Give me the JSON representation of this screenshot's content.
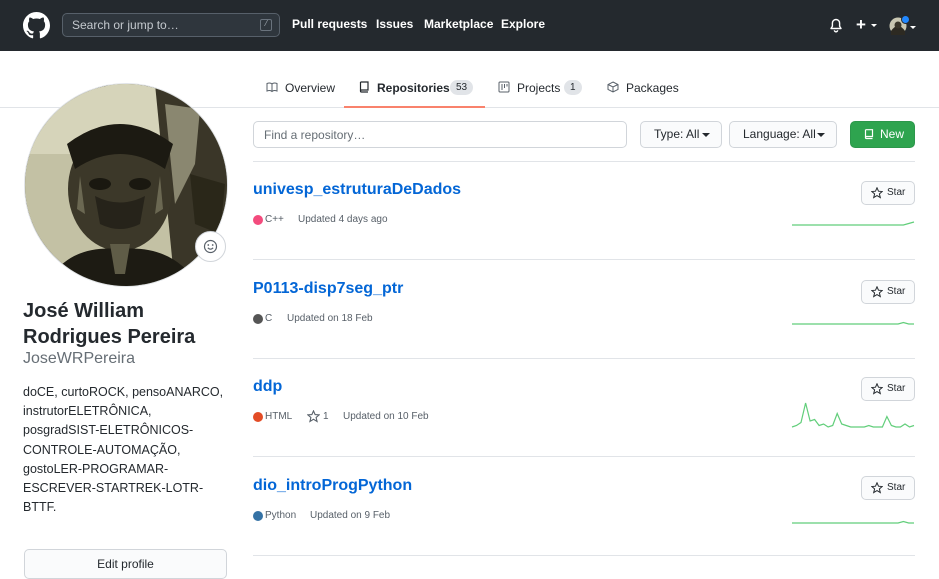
{
  "header": {
    "search_placeholder": "Search or jump to…",
    "slash_hint": "/",
    "nav": [
      "Pull requests",
      "Issues",
      "Marketplace",
      "Explore"
    ],
    "plus_label": "+"
  },
  "tabs": [
    {
      "label": "Overview",
      "count": null,
      "active": false
    },
    {
      "label": "Repositories",
      "count": "53",
      "active": true
    },
    {
      "label": "Projects",
      "count": "1",
      "active": false
    },
    {
      "label": "Packages",
      "count": null,
      "active": false
    }
  ],
  "profile": {
    "full_name": "José William Rodrigues Pereira",
    "username": "JoseWRPereira",
    "bio": "doCE, curtoROCK, pensoANARCO, instrutorELETRÔNICA, posgradSIST-ELETRÔNICOS-CONTROLE-AUTOMAÇÃO, gostoLER-PROGRAMAR-ESCREVER-STARTREK-LOTR-BTTF.",
    "edit_label": "Edit profile"
  },
  "toolbar": {
    "find_placeholder": "Find a repository…",
    "type_label": "Type: All",
    "language_label": "Language: All",
    "new_label": "New"
  },
  "repos": [
    {
      "name": "univesp_estruturaDeDados",
      "language": "C++",
      "lang_color": "#f34b7d",
      "stars": null,
      "updated": "Updated 4 days ago",
      "star_label": "Star",
      "activity": [
        0,
        0,
        0,
        0,
        0,
        0,
        0,
        0,
        0,
        0,
        0,
        0,
        0,
        0,
        0,
        0,
        0,
        0,
        0,
        0,
        0,
        0,
        1,
        2
      ]
    },
    {
      "name": "P0113-disp7seg_ptr",
      "language": "C",
      "lang_color": "#555555",
      "stars": null,
      "updated": "Updated on 18 Feb",
      "star_label": "Star",
      "activity": [
        0,
        0,
        0,
        0,
        0,
        0,
        0,
        0,
        0,
        0,
        0,
        0,
        0,
        0,
        0,
        0,
        0,
        0,
        0,
        0,
        0,
        1,
        0,
        0
      ]
    },
    {
      "name": "ddp",
      "language": "HTML",
      "lang_color": "#e34c26",
      "stars": "1",
      "updated": "Updated on 10 Feb",
      "star_label": "Star",
      "activity": [
        0,
        1,
        3,
        16,
        4,
        5,
        1,
        2,
        0,
        1,
        9,
        2,
        1,
        0,
        0,
        0,
        0,
        1,
        0,
        0,
        0,
        7,
        1,
        0,
        0,
        2,
        0,
        1
      ]
    },
    {
      "name": "dio_introProgPython",
      "language": "Python",
      "lang_color": "#3572a5",
      "stars": null,
      "updated": "Updated on 9 Feb",
      "star_label": "Star",
      "activity": [
        0,
        0,
        0,
        0,
        0,
        0,
        0,
        0,
        0,
        0,
        0,
        0,
        0,
        0,
        0,
        0,
        0,
        0,
        0,
        0,
        0,
        1,
        0,
        0
      ]
    }
  ],
  "colors": {
    "header_bg": "#24292e",
    "link": "#0366d6",
    "new_button": "#2ea44f",
    "tab_underline": "#f9826c",
    "spark": "#2cbe4e"
  },
  "icons": [
    "github-logo-icon",
    "bell-icon",
    "plus-icon",
    "book-icon",
    "repo-icon",
    "project-icon",
    "package-icon",
    "smiley-icon",
    "star-icon"
  ]
}
